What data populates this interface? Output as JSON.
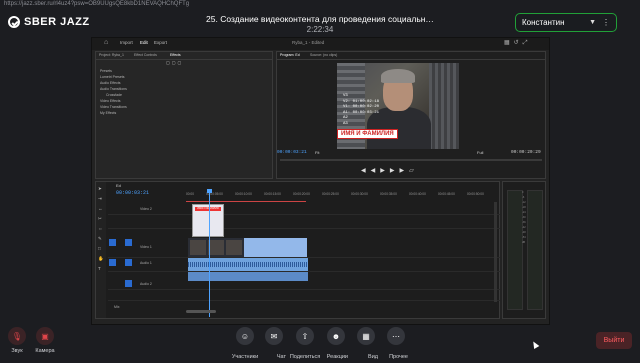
{
  "browser": {
    "url": "https://jazz.sber.ru/rl4uz4?psw=OB9UUgsQE8kbD1NEVAQHChQFTg"
  },
  "app": {
    "logo_text": "SBER JAZZ"
  },
  "meeting": {
    "title": "25. Создание видеоконтента для проведения социальн…",
    "timer": "2:22:34"
  },
  "participant": {
    "name": "Константин",
    "accent": "#21a038"
  },
  "premiere": {
    "tabs": [
      "Import",
      "Edit",
      "Export"
    ],
    "title": "Ryba_1 - Edited",
    "project_tabs": [
      "Project: Ryba_1",
      "Effect Controls",
      "Effects"
    ],
    "effects": [
      "Presets",
      "Lumetri Presets",
      "Audio Effects",
      "Audio Transitions",
      "Crossfade",
      "Video Effects",
      "Video Transitions",
      "My Effects"
    ],
    "program_tabs": [
      "Program: Ed",
      "Source: (no clips)"
    ],
    "timecode_overlay": [
      "V3",
      "V2: 01:00:02:18",
      "V1: 00:00:02:20",
      "A1: 00:00:03:21",
      "A2",
      "A3"
    ],
    "name_title": "ИМЯ И ФАМИЛИЯ",
    "program_tc": "00:00:03:21",
    "fit": "Fit",
    "full": "Full",
    "duration_tc": "00:00:20:29",
    "sequence_tab": "Ed",
    "timeline_tc": "00:00:03:21",
    "ruler": [
      "00:00",
      "00:00:05:00",
      "00:00:10:00",
      "00:00:15:00",
      "00:00:20:00",
      "00:00:25:00",
      "00:00:30:00",
      "00:00:35:00",
      "00:00:40:00",
      "00:00:45:00",
      "00:00:50:00"
    ],
    "tracks": [
      "Video 2",
      "Video 1",
      "Audio 1",
      "Audio 2",
      "Mix"
    ],
    "title_clip": "ИМЯ И ФАМИЛИЯ",
    "meter_scale": [
      "0",
      "-6",
      "-12",
      "-18",
      "-24",
      "-30",
      "-36",
      "-42",
      "-48",
      "-54",
      "dB"
    ]
  },
  "toolbar": {
    "sound": "Звук",
    "camera": "Камера",
    "participants": "Участники",
    "chat": "Чат",
    "share": "Поделиться",
    "reactions": "Реакции",
    "view": "Вид",
    "more": "Прочее",
    "leave": "Выйти"
  }
}
